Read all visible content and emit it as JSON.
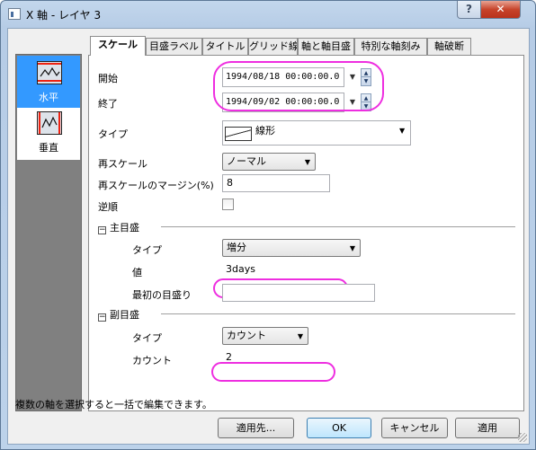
{
  "window": {
    "title": "X 軸 - レイヤ 3",
    "help_label": "?",
    "close_label": "✕"
  },
  "sidebar": {
    "items": [
      {
        "label": "水平",
        "icon": "horizontal-axis-icon",
        "selected": true
      },
      {
        "label": "垂直",
        "icon": "vertical-axis-icon",
        "selected": false
      }
    ]
  },
  "tabs": [
    {
      "label": "スケール",
      "active": true
    },
    {
      "label": "目盛ラベル"
    },
    {
      "label": "タイトル"
    },
    {
      "label": "グリッド線"
    },
    {
      "label": "軸と軸目盛"
    },
    {
      "label": "特別な軸刻み"
    },
    {
      "label": "軸破断"
    }
  ],
  "scale": {
    "start_label": "開始",
    "start_value": "1994/08/18 00:00:00.0",
    "end_label": "終了",
    "end_value": "1994/09/02 00:00:00.0",
    "type_label": "タイプ",
    "type_value": "線形",
    "rescale_label": "再スケール",
    "rescale_value": "ノーマル",
    "margin_label": "再スケールのマージン(%)",
    "margin_value": "8",
    "reverse_label": "逆順"
  },
  "major": {
    "header": "主目盛",
    "type_label": "タイプ",
    "type_value": "増分",
    "value_label": "値",
    "value_value": "3days",
    "first_label": "最初の目盛り",
    "first_value": ""
  },
  "minor": {
    "header": "副目盛",
    "type_label": "タイプ",
    "type_value": "カウント",
    "count_label": "カウント",
    "count_value": "2"
  },
  "status": "複数の軸を選択すると一括で編集できます。",
  "buttons": {
    "apply_to": "適用先...",
    "ok": "OK",
    "cancel": "キャンセル",
    "apply": "適用"
  },
  "colors": {
    "highlight": "#ee2ee0",
    "selected": "#3399ff",
    "sidebar": "#808080"
  }
}
